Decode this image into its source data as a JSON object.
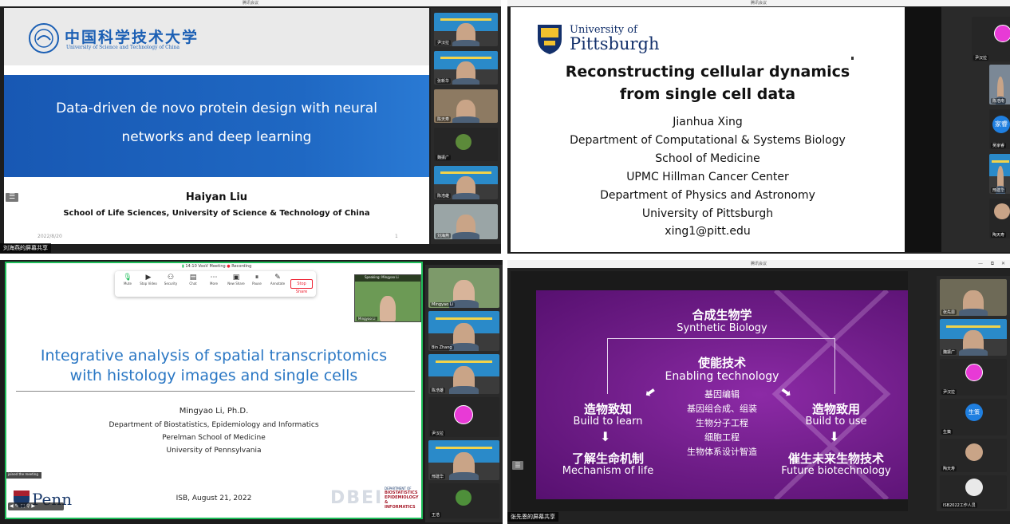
{
  "q1": {
    "window_title": "腾讯会议",
    "logo_cn": "中国科学技术大学",
    "logo_en": "University of Science and Technology of China",
    "title_line1": "Data-driven de novo protein design with neural",
    "title_line2": "networks and deep learning",
    "author": "Haiyan Liu",
    "affiliation": "School of Life Sciences, University of Science & Technology of China",
    "date": "2022/8/20",
    "page_num": "1",
    "share_label": "刘海燕的屏幕共享",
    "participants": [
      "尹汉拉",
      "张新华",
      "陈天寿",
      "魏振广",
      "陈浩雄",
      "刘海燕"
    ]
  },
  "q2": {
    "window_title": "腾讯会议",
    "univ_of": "University of",
    "univ_name": "Pittsburgh",
    "title_line1": "Reconstructing cellular dynamics",
    "title_line2": "from single cell data",
    "lines": [
      "Jianhua Xing",
      "Department of Computational & Systems Biology",
      "School of Medicine",
      "UPMC Hillman Cancer Center",
      "Department of Physics and Astronomy",
      "University of Pittsburgh",
      "xing1@pitt.edu"
    ],
    "participants": [
      "尹汉拉",
      "陈浩南",
      "吴家睿",
      "邢建华",
      "陶天寿"
    ],
    "avatar_text": "家睿"
  },
  "q3": {
    "status_time": "14:10",
    "status_app": "VooV Meeting",
    "status_rec": "Recording",
    "toolbar": [
      "Mute",
      "Stop Video",
      "Security",
      "Chat",
      "More",
      "New Share",
      "Pause",
      "Annotate"
    ],
    "stop_share": "Stop Share",
    "speaking": "Speaking: Mingyao Li",
    "self_label": "Mingyao Li",
    "title_line1": "Integrative analysis of spatial transcriptomics",
    "title_line2": "with histology images and single cells",
    "author": "Mingyao Li, Ph.D.",
    "aff1": "Department of Biostatistics, Epidemiology and Informatics",
    "aff2": "Perelman School of Medicine",
    "aff3": "University of Pennsylvania",
    "date": "ISB, August 21, 2022",
    "penn": "Penn",
    "dbei_lines": [
      "DEPARTMENT OF",
      "BIOSTATISTICS",
      "EPIDEMIOLOGY &",
      "INFORMATICS"
    ],
    "dbei_text": "DBEI",
    "notif1": "joined the meeting",
    "participants": [
      "Mingyao Li",
      "Bin Zhang",
      "陈浩雄",
      "尹汉拉",
      "邢建华",
      "王浩"
    ]
  },
  "q4": {
    "window_title": "腾讯会议",
    "window_controls": [
      "—",
      "⧉",
      "✕"
    ],
    "top_cn": "合成生物学",
    "top_en": "Synthetic Biology",
    "mid_cn": "使能技术",
    "mid_en": "Enabling technology",
    "techs": [
      "基因编辑",
      "基因组合成、组装",
      "生物分子工程",
      "细胞工程",
      "生物体系设计智造"
    ],
    "left_cn": "造物致知",
    "left_en": "Build to learn",
    "right_cn": "造物致用",
    "right_en": "Build to use",
    "bl_cn": "了解生命机制",
    "bl_en": "Mechanism of life",
    "br_cn": "催生未来生物技术",
    "br_en": "Future biotechnology",
    "share_label": "张先恩的屏幕共享",
    "participants": [
      "张先恩",
      "魏振广",
      "尹汉拉",
      "生策",
      "陶天寿",
      "ISB2022工作人员"
    ],
    "avatar_text": "生策"
  },
  "colors": {
    "ustc_blue": "#1b5fb4",
    "pitt_blue": "#13306b",
    "penn_blue": "#2a77c4",
    "purple": "#6d1c86",
    "accent_yellow": "#f2d34a",
    "pink": "#e83ad6"
  }
}
